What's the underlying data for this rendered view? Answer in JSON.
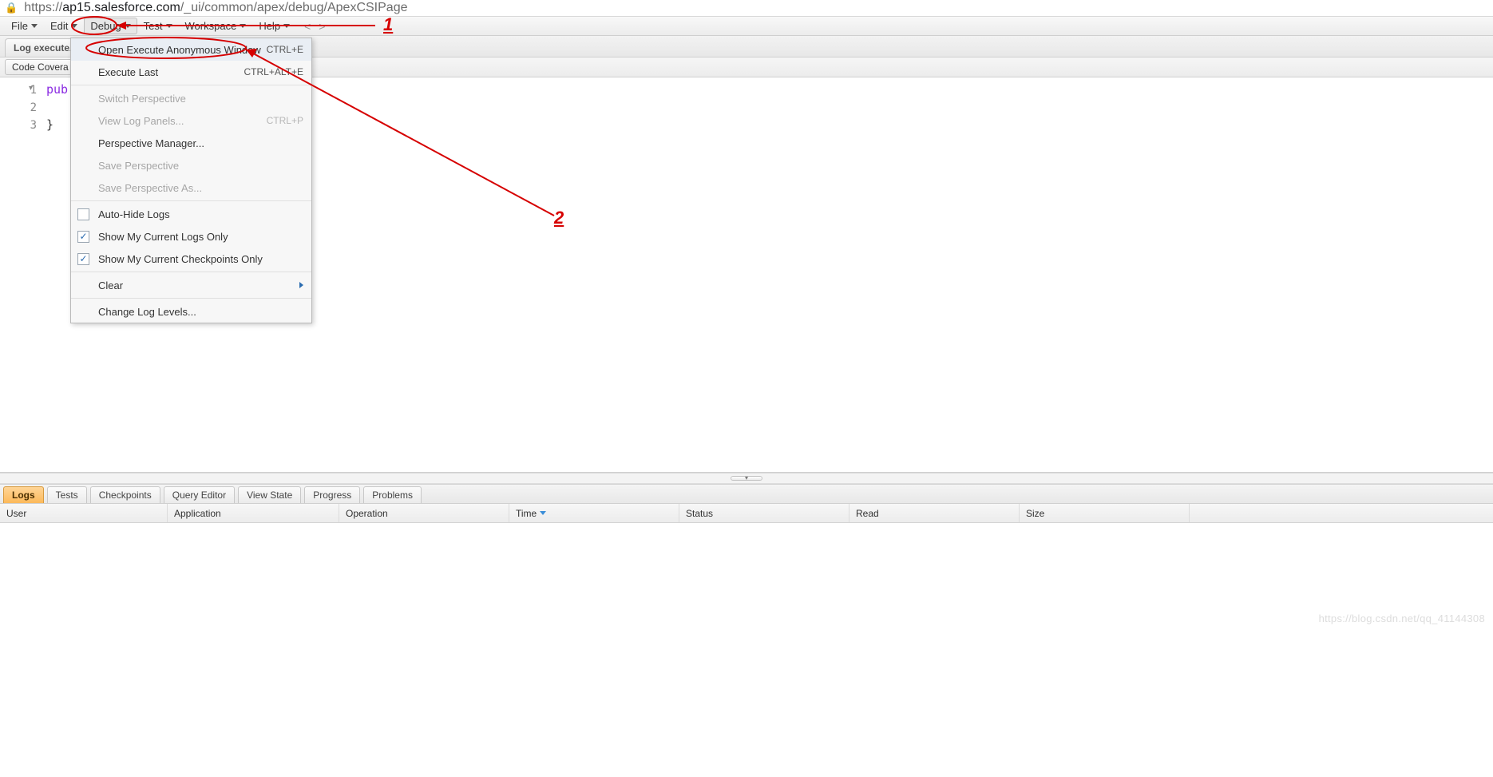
{
  "url": {
    "lock_icon": "🔒",
    "prefix": "https://",
    "host": "ap15.salesforce.com",
    "path": "/_ui/common/apex/debug/ApexCSIPage"
  },
  "menubar": {
    "items": [
      {
        "label": "File"
      },
      {
        "label": "Edit"
      },
      {
        "label": "Debug"
      },
      {
        "label": "Test"
      },
      {
        "label": "Workspace"
      },
      {
        "label": "Help"
      }
    ]
  },
  "doc_tab_label": "Log executeA",
  "subtoolbar_btn": "Code Covera",
  "editor": {
    "lines": [
      "1",
      "2",
      "3"
    ],
    "code_kw": "pub",
    "brace": "}"
  },
  "debug_menu": {
    "items": [
      {
        "label": "Open Execute Anonymous Window",
        "shortcut": "CTRL+E",
        "highlight": true
      },
      {
        "label": "Execute Last",
        "shortcut": "CTRL+ALT+E"
      },
      {
        "sep": true
      },
      {
        "label": "Switch Perspective",
        "disabled": true
      },
      {
        "label": "View Log Panels...",
        "shortcut": "CTRL+P",
        "disabled": true
      },
      {
        "label": "Perspective Manager..."
      },
      {
        "label": "Save Perspective",
        "disabled": true
      },
      {
        "label": "Save Perspective As...",
        "disabled": true
      },
      {
        "sep": true
      },
      {
        "label": "Auto-Hide Logs",
        "checkbox": true,
        "checked": false
      },
      {
        "label": "Show My Current Logs Only",
        "checkbox": true,
        "checked": true
      },
      {
        "label": "Show My Current Checkpoints Only",
        "checkbox": true,
        "checked": true
      },
      {
        "sep": true
      },
      {
        "label": "Clear",
        "submenu": true
      },
      {
        "sep": true
      },
      {
        "label": "Change Log Levels..."
      }
    ]
  },
  "bottom_tabs": [
    "Logs",
    "Tests",
    "Checkpoints",
    "Query Editor",
    "View State",
    "Progress",
    "Problems"
  ],
  "columns": [
    "User",
    "Application",
    "Operation",
    "Time",
    "Status",
    "Read",
    "Size"
  ],
  "sorted_column": "Time",
  "watermark": "https://blog.csdn.net/qq_41144308",
  "annotation": {
    "label1": "1",
    "label2": "2"
  }
}
